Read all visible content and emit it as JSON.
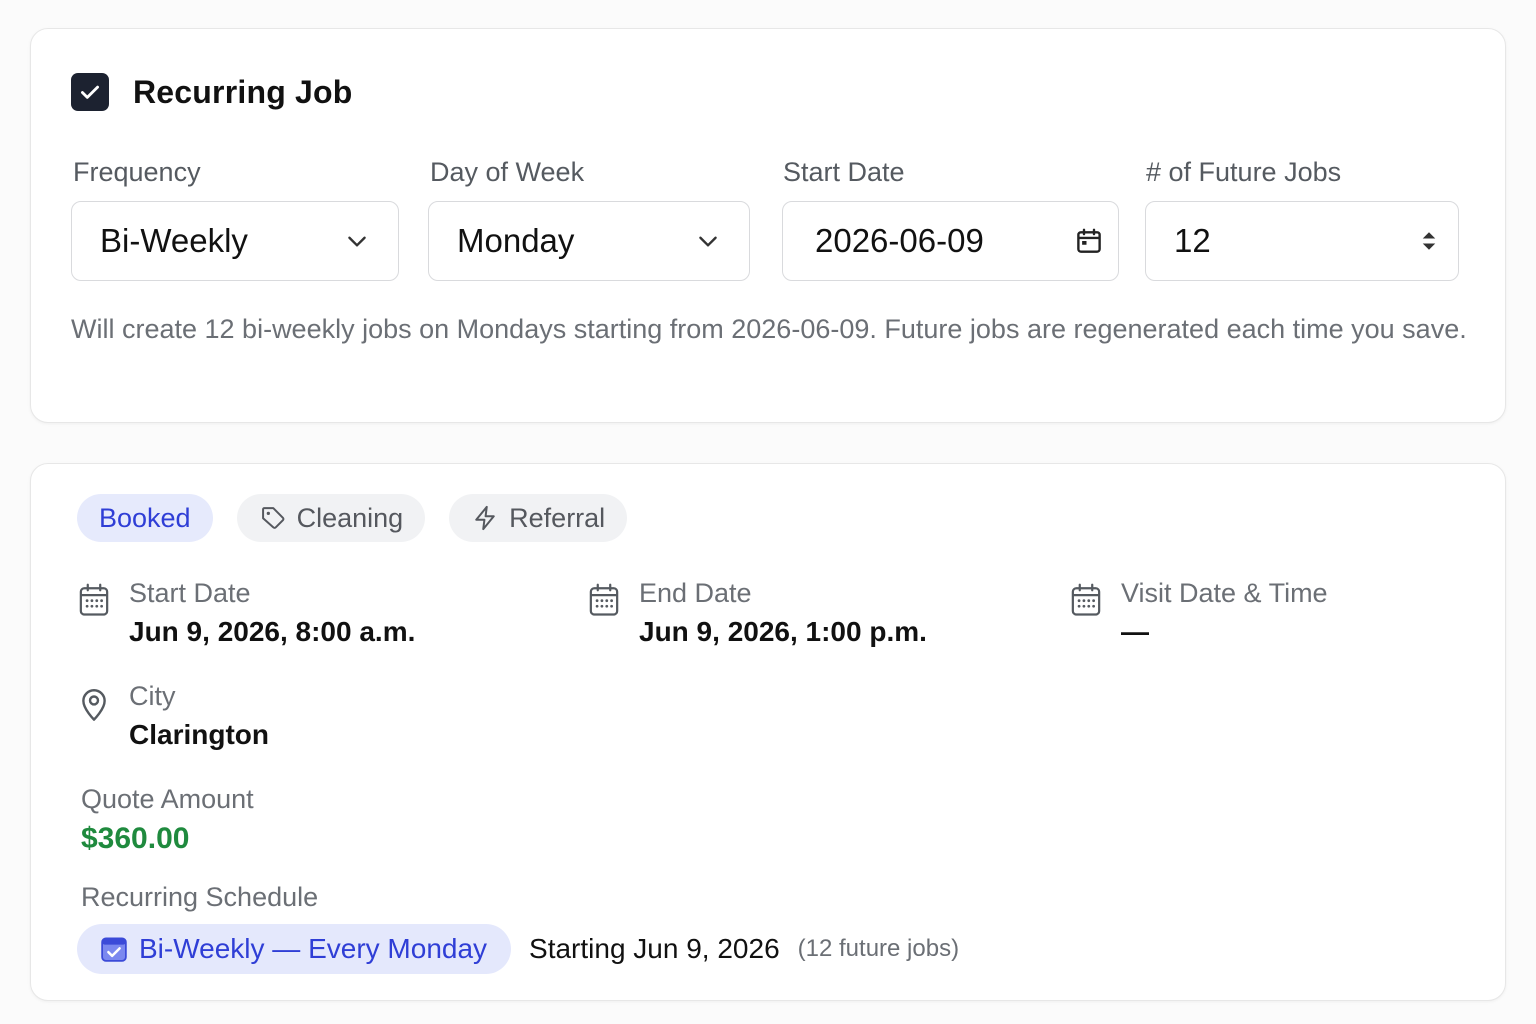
{
  "recurring": {
    "checkbox_checked": true,
    "title": "Recurring Job",
    "fields": {
      "frequency": {
        "label": "Frequency",
        "value": "Bi-Weekly"
      },
      "day_of_week": {
        "label": "Day of Week",
        "value": "Monday"
      },
      "start_date": {
        "label": "Start Date",
        "value": "2026-06-09"
      },
      "future_jobs": {
        "label": "# of Future Jobs",
        "value": "12"
      }
    },
    "helper_text": "Will create 12 bi-weekly jobs on Mondays starting from 2026-06-09. Future jobs are regenerated each time you save."
  },
  "details": {
    "tags": {
      "status": "Booked",
      "service": "Cleaning",
      "source": "Referral"
    },
    "start_date": {
      "label": "Start Date",
      "value": "Jun 9, 2026, 8:00 a.m."
    },
    "end_date": {
      "label": "End Date",
      "value": "Jun 9, 2026, 1:00 p.m."
    },
    "visit": {
      "label": "Visit Date & Time",
      "value": "—"
    },
    "city": {
      "label": "City",
      "value": "Clarington"
    },
    "quote": {
      "label": "Quote Amount",
      "value": "$360.00"
    },
    "schedule": {
      "label": "Recurring Schedule",
      "pill": "Bi-Weekly — Every Monday",
      "starting": "Starting Jun 9, 2026",
      "count": "(12 future jobs)"
    }
  },
  "colors": {
    "accent_blue": "#2f3ed6",
    "pill_blue_bg": "#e4e8fc",
    "money_green": "#1f8a3e",
    "checkbox_dark": "#1c2230"
  },
  "icons": {
    "checkbox": "check-icon",
    "dropdown": "chevron-down-icon",
    "date_picker": "calendar-icon",
    "stepper": "updown-arrows-icon",
    "tag_service": "tag-icon",
    "tag_source": "lightning-icon",
    "date_fields": "calendar-grid-icon",
    "city": "map-pin-icon",
    "schedule": "calendar-check-icon"
  }
}
